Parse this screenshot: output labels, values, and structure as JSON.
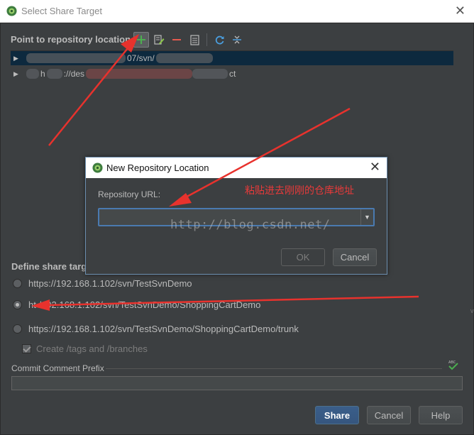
{
  "window": {
    "title": "Select Share Target"
  },
  "repo_section": {
    "header": "Point to repository location"
  },
  "tree": {
    "rows": [
      {
        "text": "07/svn/",
        "selected": true
      },
      {
        "text_a": "h",
        "text_b": "://des",
        "text_c": "ct",
        "selected": false
      }
    ]
  },
  "define_section": {
    "header": "Define share targ"
  },
  "targets": [
    {
      "label": "https://192.168.1.102/svn/TestSvnDemo",
      "checked": false
    },
    {
      "label": "ht    /192.168.1.102/svn/TestSvnDemo/ShoppingCartDemo",
      "checked": true
    },
    {
      "label": "https://192.168.1.102/svn/TestSvnDemo/ShoppingCartDemo/trunk",
      "checked": false
    }
  ],
  "create_tags": {
    "label": "Create /tags and /branches",
    "checked": true
  },
  "commit_prefix": {
    "label": "Commit Comment Prefix",
    "value": ""
  },
  "buttons": {
    "share": "Share",
    "cancel": "Cancel",
    "help": "Help"
  },
  "dialog": {
    "title": "New Repository Location",
    "url_label": "Repository URL:",
    "url_value": "",
    "annotation": "粘贴进去刚刚的仓库地址",
    "ok": "OK",
    "cancel": "Cancel"
  },
  "watermark": "http://blog.csdn.net/",
  "colors": {
    "background": "#3c3f41",
    "selection": "#0d293e",
    "accent": "#4a7ab0",
    "annotation_red": "#e83a3a"
  }
}
